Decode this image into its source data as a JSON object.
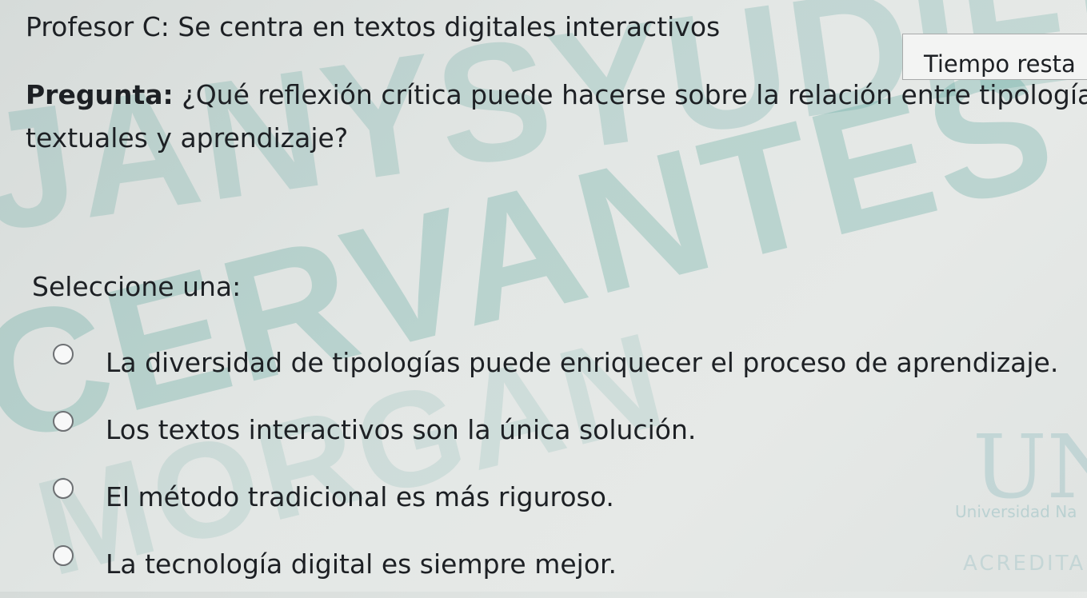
{
  "header": {
    "teacher_line": "Profesor C: Se centra en textos digitales interactivos",
    "timer_label": "Tiempo resta"
  },
  "question": {
    "label": "Pregunta:",
    "text_line1": " ¿Qué reflexión crítica puede hacerse sobre la relación entre tipologías",
    "text_line2": "textuales y aprendizaje?"
  },
  "answers": {
    "prompt": "Seleccione una:",
    "options": [
      {
        "label": "La diversidad de tipologías puede enriquecer el proceso de aprendizaje.",
        "selected": false
      },
      {
        "label": "Los textos interactivos son la única solución.",
        "selected": false
      },
      {
        "label": "El método tradicional es más riguroso.",
        "selected": false
      },
      {
        "label": "La tecnología digital es siempre mejor.",
        "selected": false
      }
    ]
  },
  "watermark": {
    "text_top": "JANYSYUDIEH",
    "text_middle": "CERVANTES",
    "text_bottom": "MORGAN",
    "logo_letters": "UN",
    "logo_caption": "Universidad Na",
    "logo_footer": "ACREDITA"
  },
  "colors": {
    "watermark_accent": "#3c968c",
    "radio_border": "#6d7073"
  }
}
